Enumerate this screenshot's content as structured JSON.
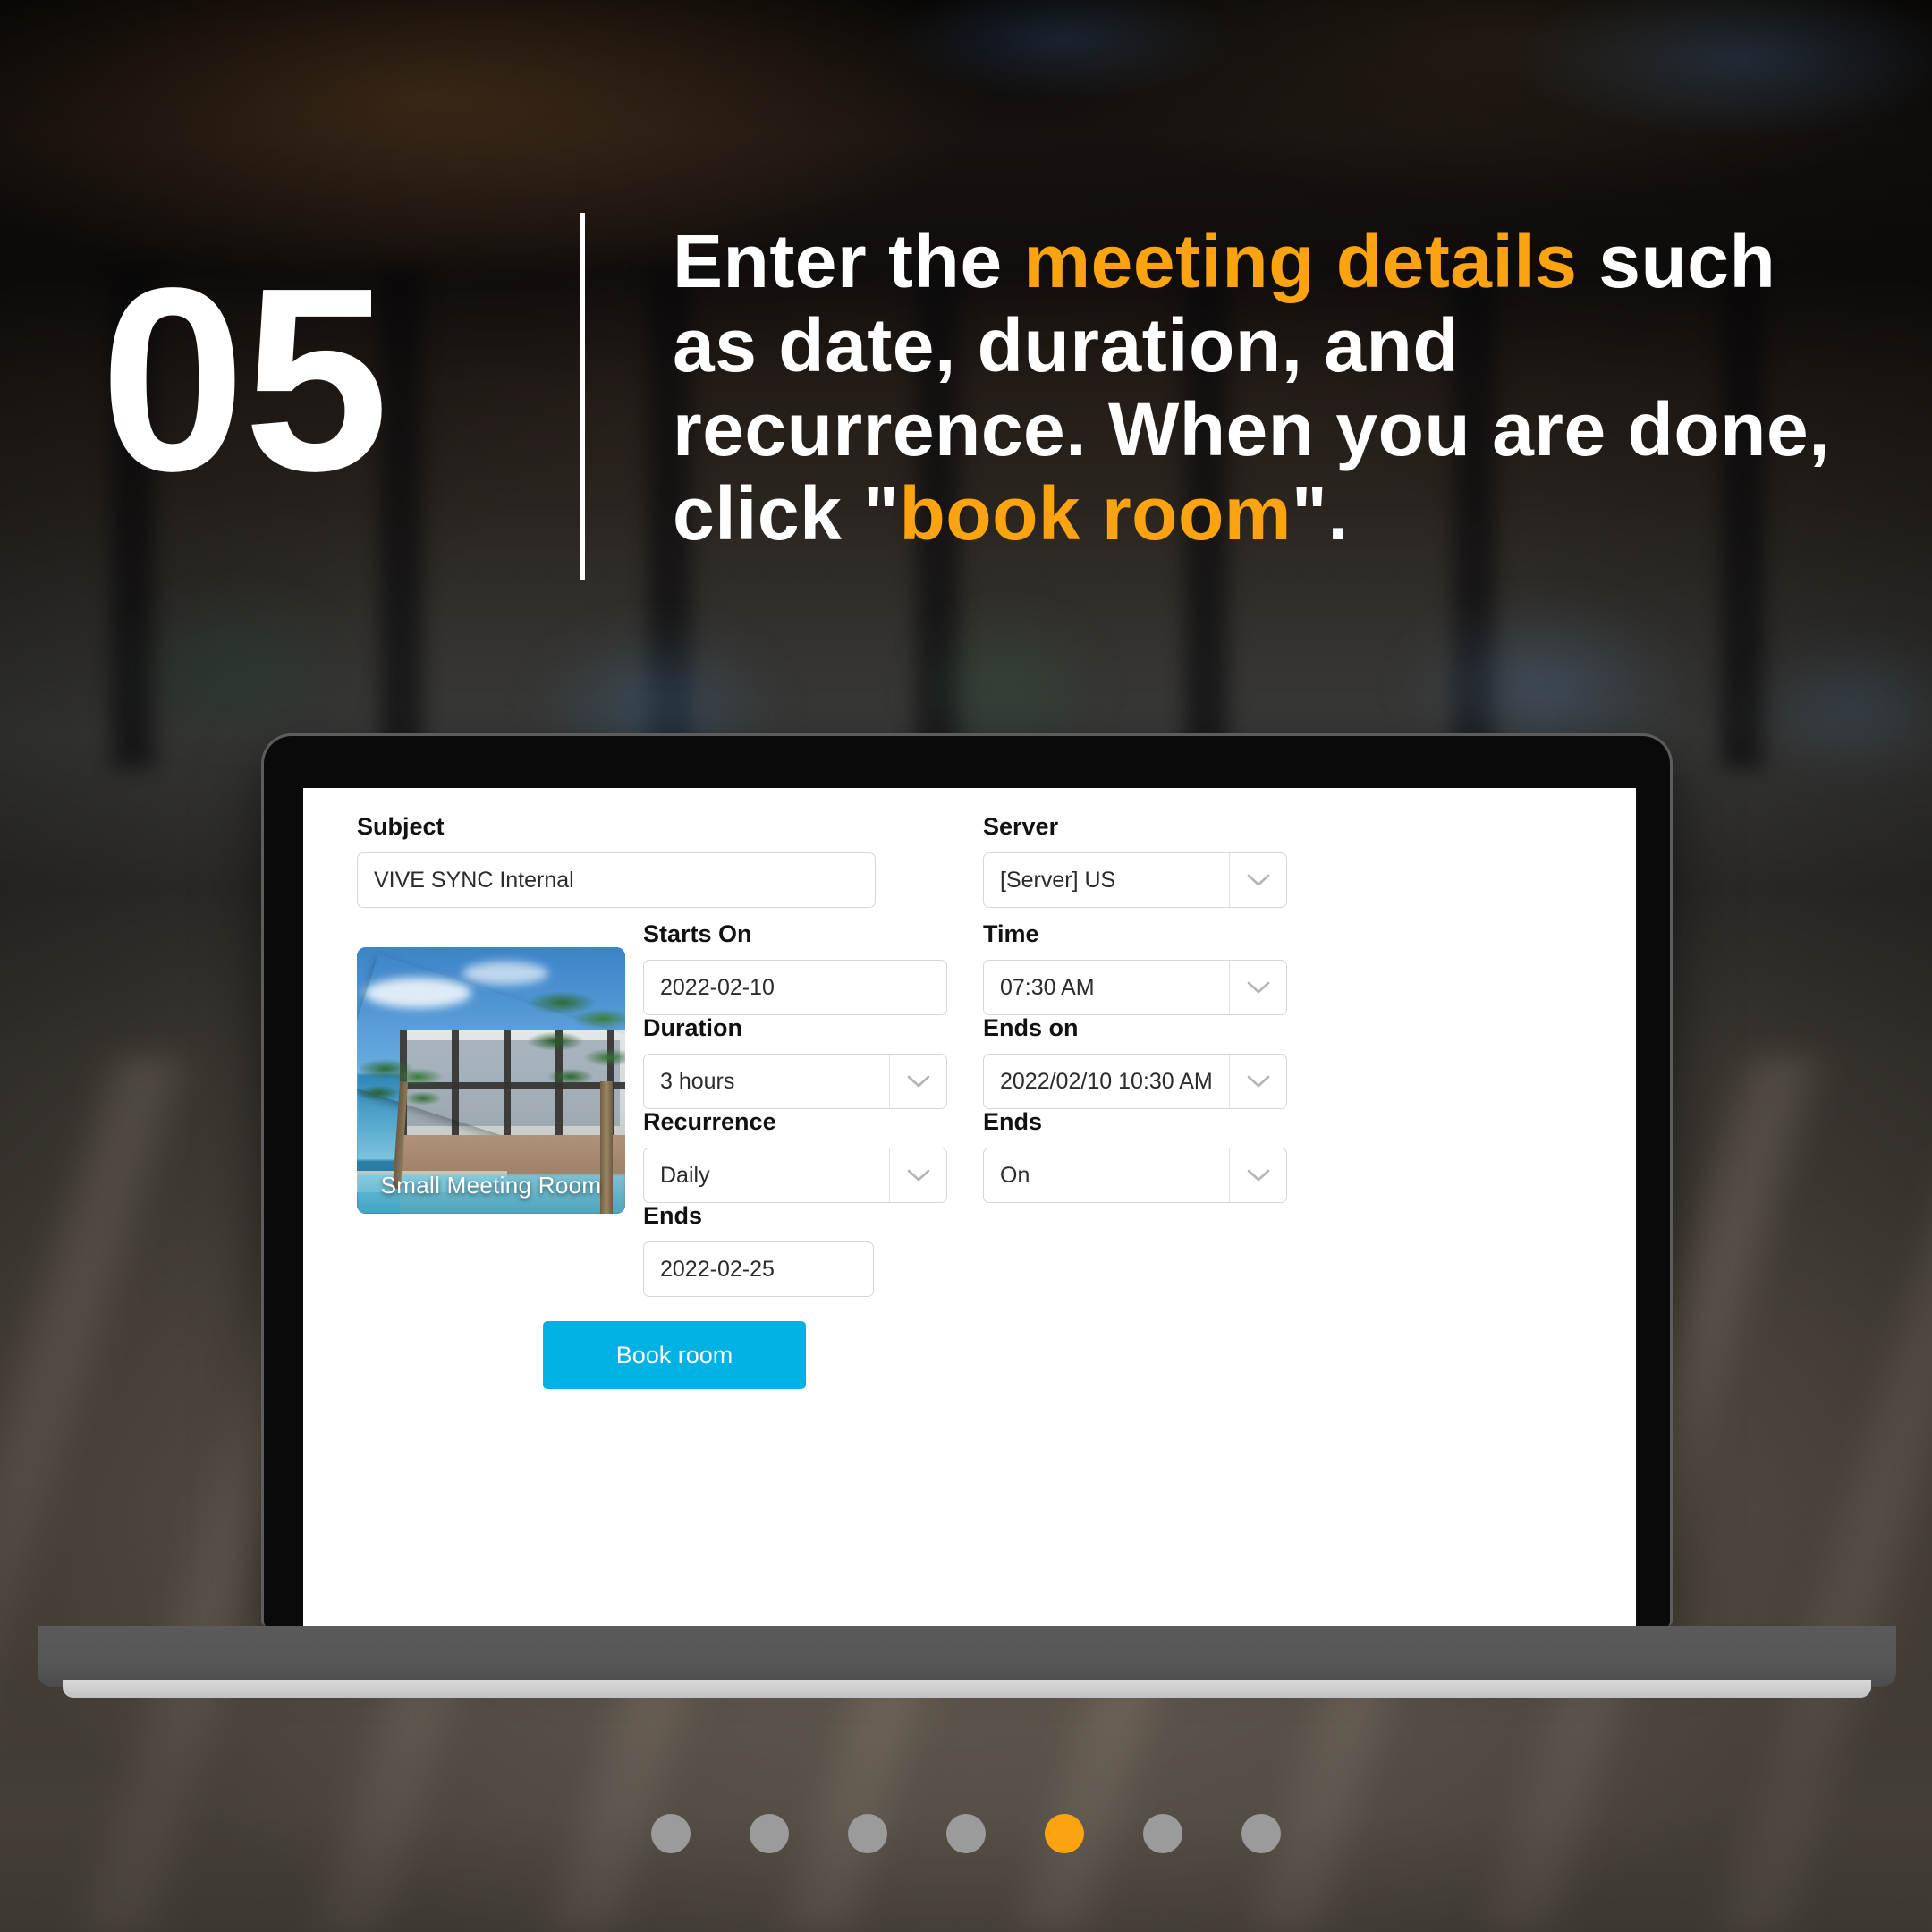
{
  "step": {
    "number": "05",
    "headline_parts": [
      {
        "text": "Enter the ",
        "highlight": false
      },
      {
        "text": "meeting details",
        "highlight": true
      },
      {
        "text": " such as date, duration, and recurrence. When you are done, click \"",
        "highlight": false
      },
      {
        "text": "book room",
        "highlight": true
      },
      {
        "text": "\".",
        "highlight": false
      }
    ],
    "headline_plain": "Enter the meeting details such as date, duration, and recurrence. When you are done, click \"book room\"."
  },
  "colors": {
    "accent_orange": "#fca311",
    "button_blue": "#00b2e3",
    "text_white": "#ffffff",
    "label_black": "#111111"
  },
  "form": {
    "subject": {
      "label": "Subject",
      "value": "VIVE SYNC Internal",
      "placeholder": "Subject"
    },
    "room_thumbnail": {
      "caption": "Small Meeting Room"
    },
    "starts_on": {
      "label": "Starts On",
      "value": "2022-02-10",
      "placeholder": "YYYY-MM-DD"
    },
    "duration": {
      "label": "Duration",
      "value": "3 hours",
      "icon": "chevron-down-icon"
    },
    "recurrence": {
      "label": "Recurrence",
      "value": "Daily",
      "icon": "chevron-down-icon"
    },
    "recurrence_ends": {
      "label": "Ends",
      "value": "2022-02-25",
      "placeholder": "YYYY-MM-DD"
    },
    "server": {
      "label": "Server",
      "value": "[Server] US",
      "icon": "chevron-down-icon"
    },
    "time": {
      "label": "Time",
      "value": "07:30 AM",
      "icon": "chevron-down-icon"
    },
    "ends_on": {
      "label": "Ends on",
      "value": "2022/02/10 10:30 AM",
      "icon": "chevron-down-icon"
    },
    "ends_mode": {
      "label": "Ends",
      "value": "On",
      "icon": "chevron-down-icon"
    },
    "submit": {
      "label": "Book room"
    }
  },
  "pagination": {
    "total": 7,
    "active_index": 4
  }
}
